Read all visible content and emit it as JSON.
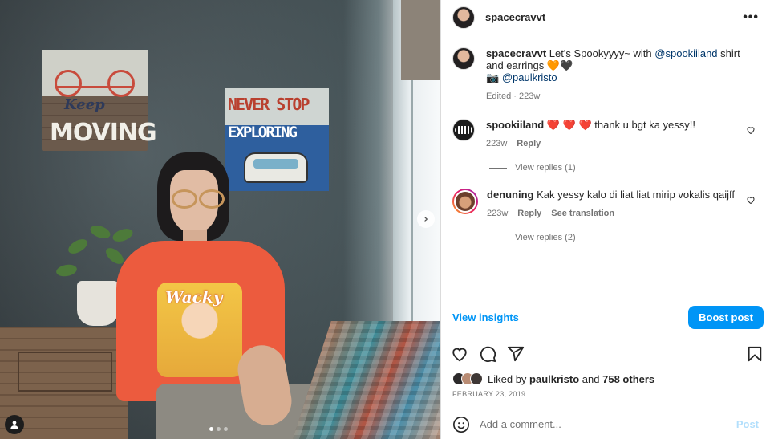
{
  "post": {
    "username": "spacecravvt",
    "more_label": "•••"
  },
  "caption": {
    "username": "spacecravvt",
    "text_before": "Let's Spookyyyy~ with",
    "mention1": "@spookiiland",
    "text_after": "shirt and earrings 🧡🖤",
    "line2_icon": "📷",
    "mention2": "@paulkristo",
    "meta": "Edited · 223w"
  },
  "comments": [
    {
      "username": "spookiiland",
      "text": "❤️ ❤️ ❤️  thank u bgt ka yessy!!",
      "time": "223w",
      "reply": "Reply",
      "view_replies": "View replies (1)"
    },
    {
      "username": "denuning",
      "text": "Kak yessy kalo di liat liat mirip vokalis qaijff",
      "time": "223w",
      "reply": "Reply",
      "translation": "See translation",
      "view_replies": "View replies (2)"
    }
  ],
  "insights": {
    "view_label": "View insights",
    "boost_label": "Boost post"
  },
  "likes": {
    "prefix": "Liked by",
    "user": "paulkristo",
    "and": "and",
    "others": "758 others"
  },
  "date": "FEBRUARY 23, 2019",
  "comment_box": {
    "placeholder": "Add a comment...",
    "post_label": "Post"
  },
  "photo": {
    "sign1_keep": "Keep",
    "sign1_moving": "MOVING",
    "sign2_never": "NEVER STOP",
    "sign2_exploring": "EXPLORING",
    "shirt_text": "Wacky"
  },
  "carousel": {
    "next_label": "›",
    "slides": 3,
    "active": 1
  },
  "icons": [
    "heart-icon",
    "comment-icon",
    "share-icon",
    "bookmark-icon",
    "emoji-icon",
    "user-tag-icon",
    "more-icon"
  ],
  "colors": {
    "accent": "#0095f6",
    "link": "#00376b",
    "muted": "#737373",
    "post_disabled": "#b2dffc"
  }
}
